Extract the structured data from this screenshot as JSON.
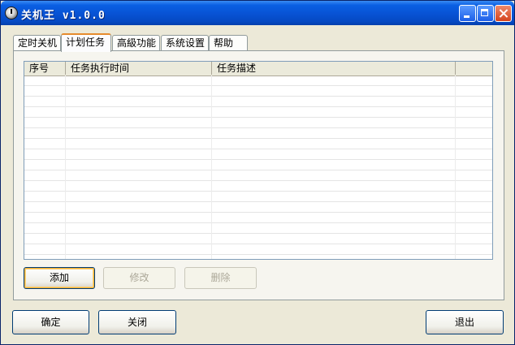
{
  "window": {
    "title": "关机王 v1.0.0"
  },
  "tabs": [
    {
      "label": "定时关机"
    },
    {
      "label": "计划任务",
      "active": true
    },
    {
      "label": "高級功能"
    },
    {
      "label": "系统设置"
    },
    {
      "label": "帮助"
    }
  ],
  "task_list": {
    "columns": [
      "序号",
      "任务执行时间",
      "任务描述",
      ""
    ],
    "rows": []
  },
  "task_buttons": {
    "add": "添加",
    "edit": "修改",
    "delete": "删除"
  },
  "footer_buttons": {
    "ok": "确定",
    "close": "关闭",
    "exit": "退出"
  },
  "colors": {
    "title_bar": "#0854d6",
    "active_tab_accent": "#e68b2c",
    "button_border": "#003c74"
  }
}
